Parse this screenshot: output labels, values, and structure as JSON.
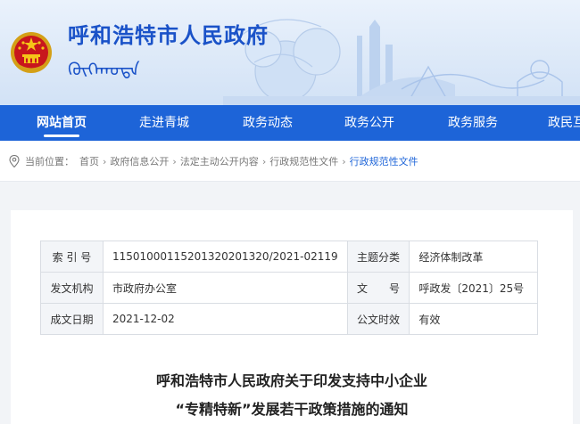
{
  "header": {
    "site_title": "呼和浩特市人民政府",
    "mongol_title": "ᠬᠥᠬᠡᠬᠣᠲᠠ"
  },
  "nav": {
    "items": [
      {
        "label": "网站首页",
        "active": true
      },
      {
        "label": "走进青城",
        "active": false
      },
      {
        "label": "政务动态",
        "active": false
      },
      {
        "label": "政务公开",
        "active": false
      },
      {
        "label": "政务服务",
        "active": false
      },
      {
        "label": "政民互",
        "active": false
      }
    ]
  },
  "breadcrumb": {
    "prefix": "当前位置：",
    "items": [
      "首页",
      "政府信息公开",
      "法定主动公开内容",
      "行政规范性文件"
    ],
    "current": "行政规范性文件"
  },
  "info_table": {
    "index_label": "索 引 号",
    "index_value": "115010001152013202013​20/2021-02119",
    "topic_label": "主题分类",
    "topic_value": "经济体制改革",
    "issuer_label": "发文机构",
    "issuer_value": "市政府办公室",
    "doc_no_label": "文　　号",
    "doc_no_value": "呼政发〔2021〕25号",
    "date_label": "成文日期",
    "date_value": "2021-12-02",
    "validity_label": "公文时效",
    "validity_value": "有效"
  },
  "document": {
    "title_line1": "呼和浩特市人民政府关于印发支持中小企业",
    "title_line2": "“专精特新”发展若干政策措施的通知"
  },
  "colors": {
    "brand_blue": "#1d64d8",
    "title_blue": "#1a52c8"
  }
}
